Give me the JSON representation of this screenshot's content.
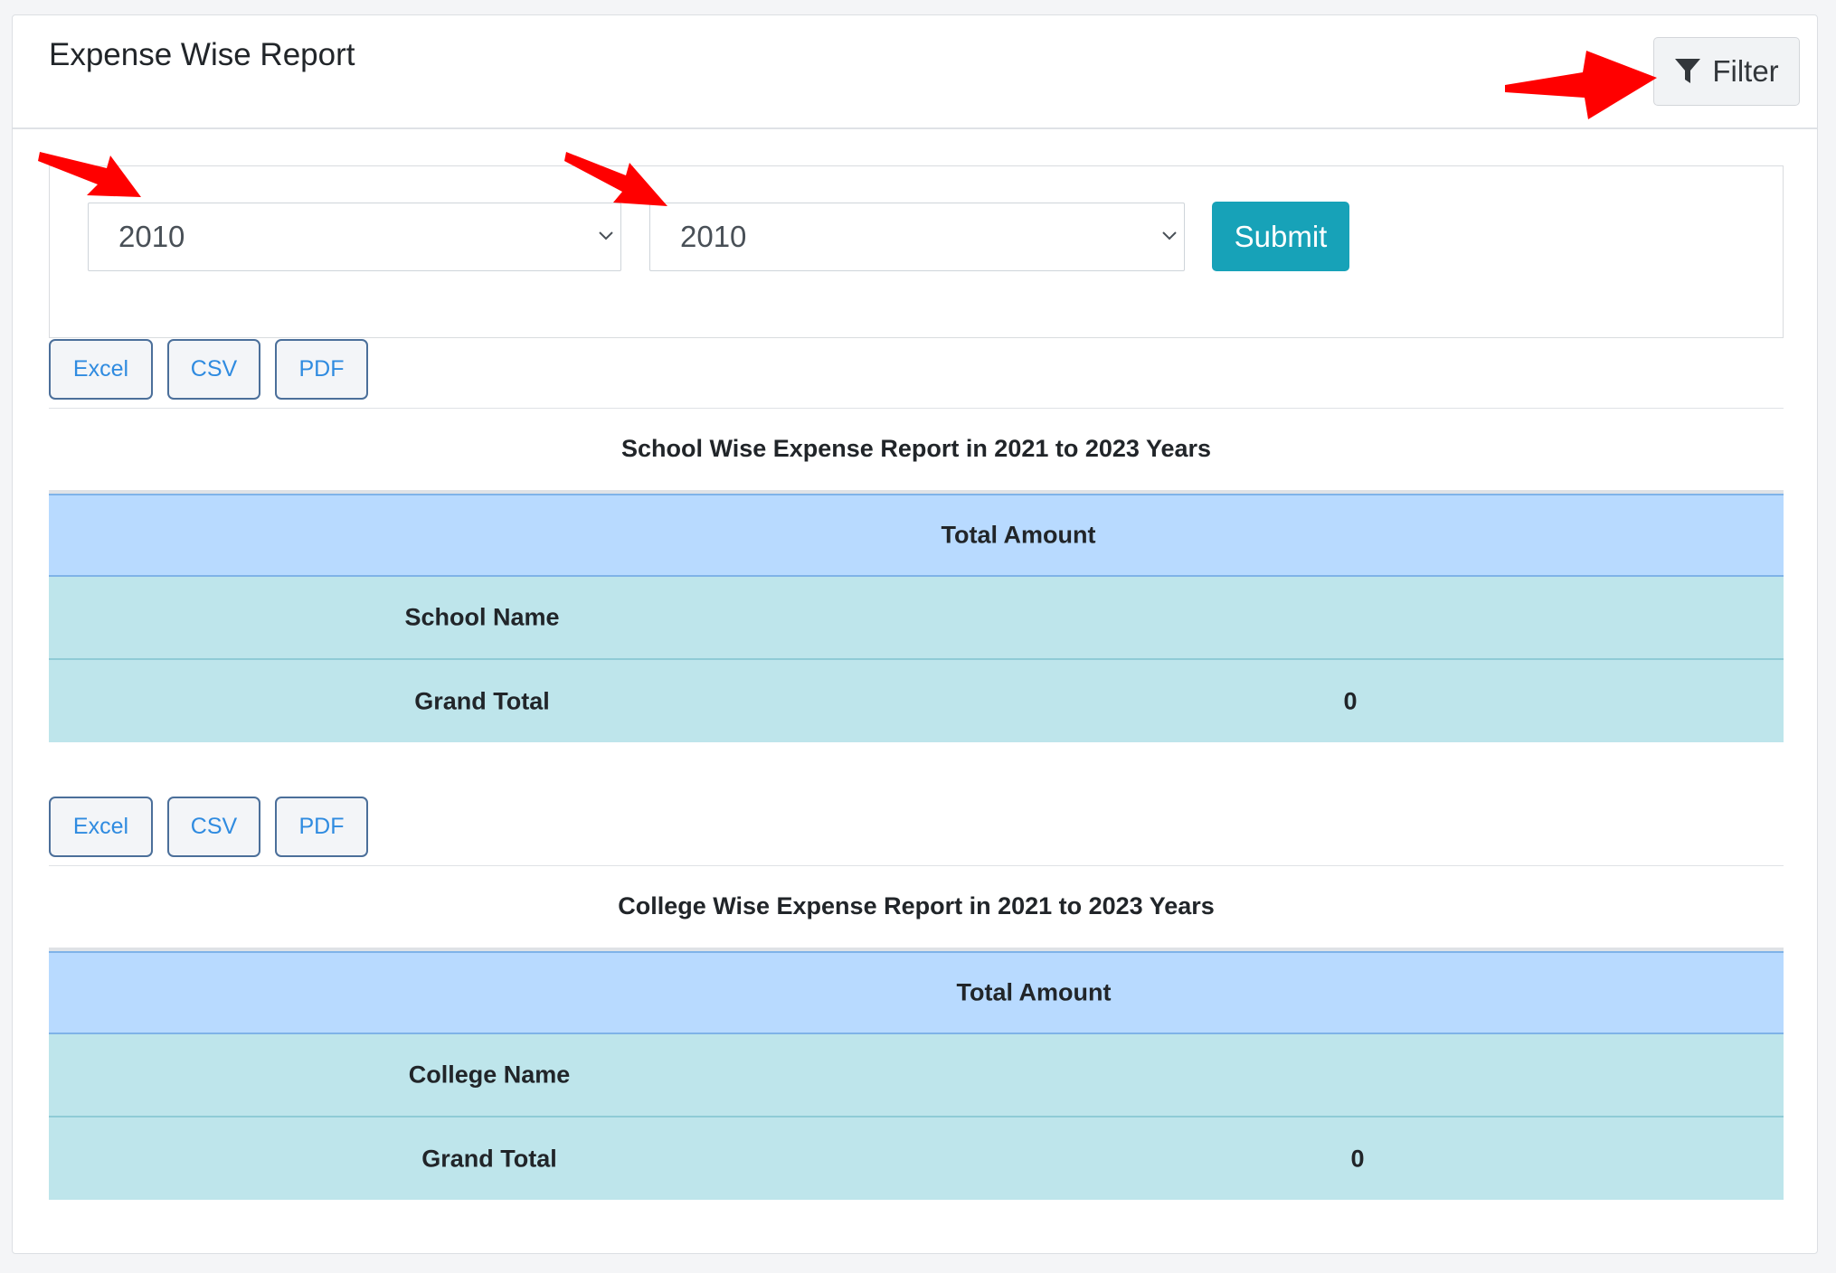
{
  "header": {
    "title": "Expense Wise Report",
    "filter_label": "Filter"
  },
  "filters": {
    "from_year": "2010",
    "to_year": "2010",
    "submit_label": "Submit"
  },
  "export_buttons": [
    "Excel",
    "CSV",
    "PDF"
  ],
  "school_report": {
    "title": "School Wise Expense Report in 2021 to 2023 Years",
    "header": "Total Amount",
    "name_label": "School Name",
    "grand_total_label": "Grand Total",
    "grand_total_value": "0"
  },
  "college_report": {
    "title": "College Wise Expense Report in 2021 to 2023 Years",
    "header": "Total Amount",
    "name_label": "College Name",
    "grand_total_label": "Grand Total",
    "grand_total_value": "0"
  },
  "colors": {
    "accent": "#17a2b8",
    "table_head": "#b8daff",
    "table_info": "#bee5eb",
    "annotation_arrow": "#ff0000"
  }
}
